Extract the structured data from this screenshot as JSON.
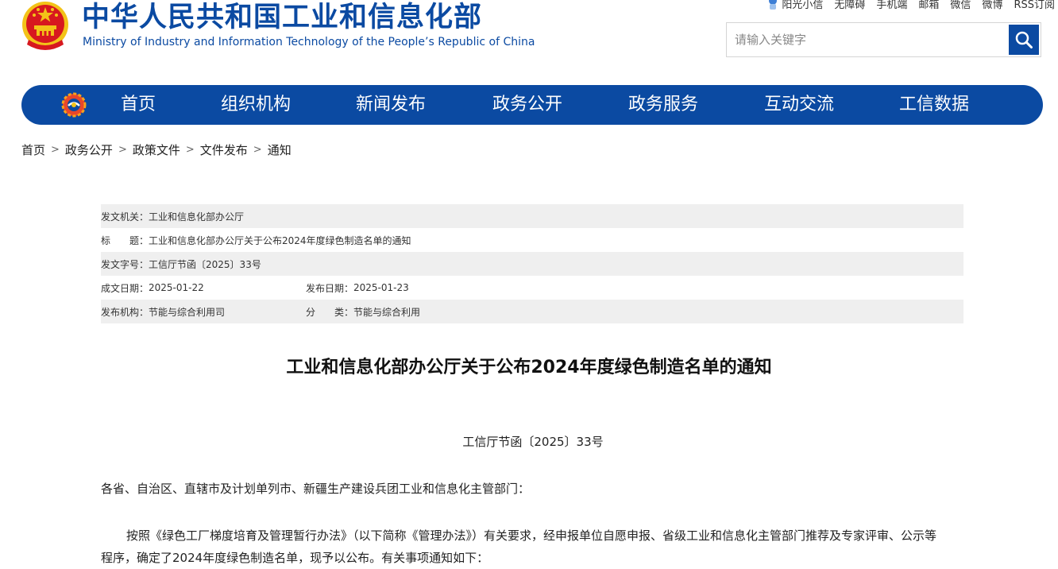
{
  "header": {
    "title_zh": "中华人民共和国工业和信息化部",
    "title_en": "Ministry of Industry and Information Technology of the People’s Republic of China",
    "top_links": [
      "阳光小信",
      "无障碍",
      "手机端",
      "邮箱",
      "微信",
      "微博",
      "RSS订阅"
    ],
    "search": {
      "placeholder": "请输入关键字"
    }
  },
  "nav": {
    "items": [
      "首页",
      "组织机构",
      "新闻发布",
      "政务公开",
      "政务服务",
      "互动交流",
      "工信数据"
    ]
  },
  "breadcrumb": [
    "首页",
    "政务公开",
    "政策文件",
    "文件发布",
    "通知"
  ],
  "meta": {
    "issuer_label": "发文机关：",
    "issuer": "工业和信息化部办公厅",
    "title_label": "标　　题：",
    "title": "工业和信息化部办公厅关于公布2024年度绿色制造名单的通知",
    "docno_label": "发文字号：",
    "docno": "工信厅节函〔2025〕33号",
    "written_label": "成文日期：",
    "written": "2025-01-22",
    "published_label": "发布日期：",
    "published": "2025-01-23",
    "agency_label": "发布机构：",
    "agency": "节能与综合利用司",
    "category_label": "分　　类：",
    "category": "节能与综合利用"
  },
  "article": {
    "title": "工业和信息化部办公厅关于公布2024年度绿色制造名单的通知",
    "doc_number": "工信厅节函〔2025〕33号",
    "salutation": "各省、自治区、直辖市及计划单列市、新疆生产建设兵团工业和信息化主管部门：",
    "paragraph": "按照《绿色工厂梯度培育及管理暂行办法》（以下简称《管理办法》）有关要求，经申报单位自愿申报、省级工业和信息化主管部门推荐及专家评审、公示等程序，确定了2024年度绿色制造名单，现予以公布。有关事项通知如下："
  },
  "colors": {
    "brand_blue": "#0b4aa2",
    "emblem_red": "#d7181f",
    "emblem_gold": "#f3c318"
  }
}
